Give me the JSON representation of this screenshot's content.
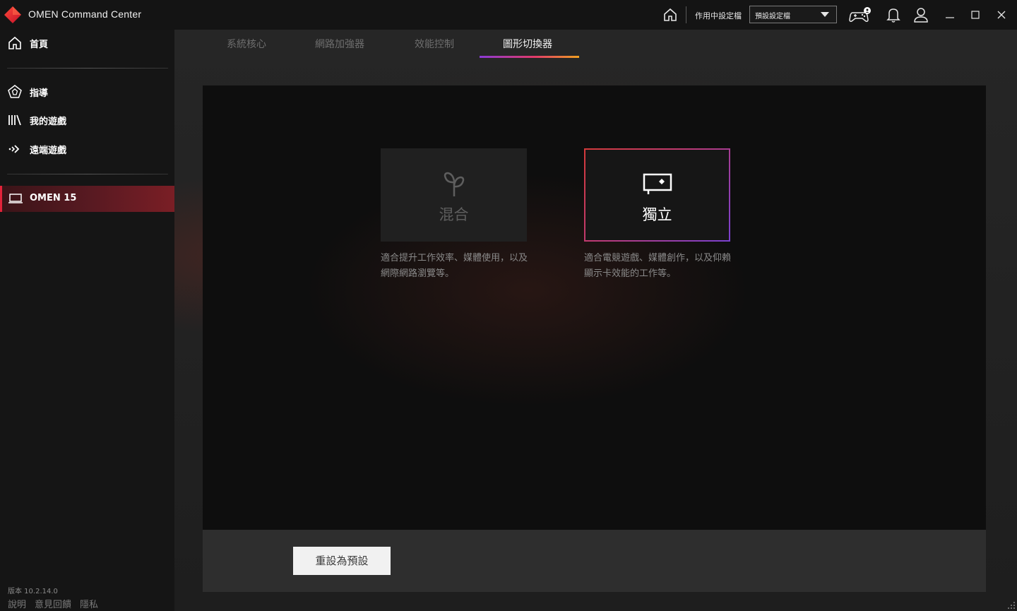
{
  "app": {
    "title": "OMEN Command Center"
  },
  "titlebar": {
    "profile_label": "作用中設定檔",
    "profile_select_value": "預設設定檔",
    "icons": [
      "home-icon",
      "controller-icon",
      "bell-icon",
      "user-icon",
      "minimize-icon",
      "maximize-icon",
      "close-icon"
    ]
  },
  "sidebar": {
    "home": "首頁",
    "items": [
      {
        "label": "指導",
        "icon": "coach-icon"
      },
      {
        "label": "我的遊戲",
        "icon": "library-icon"
      },
      {
        "label": "遠端遊戲",
        "icon": "remote-play-icon"
      }
    ],
    "device": "OMEN 15",
    "version": "版本 10.2.14.0",
    "footer": [
      "說明",
      "意見回饋",
      "隱私"
    ]
  },
  "tabs": [
    {
      "label": "系統核心",
      "active": false
    },
    {
      "label": "網路加強器",
      "active": false
    },
    {
      "label": "效能控制",
      "active": false
    },
    {
      "label": "圖形切換器",
      "active": true
    }
  ],
  "modes": {
    "hybrid": {
      "label": "混合",
      "description": "適合提升工作效率、媒體使用，以及網際網路瀏覽等。",
      "selected": false,
      "icon": "sprout-icon"
    },
    "discrete": {
      "label": "獨立",
      "description": "適合電競遊戲、媒體創作，以及仰賴顯示卡效能的工作等。",
      "selected": true,
      "icon": "display-icon"
    }
  },
  "reset_button": "重設為預設",
  "colors": {
    "accent_red": "#e2233a",
    "tab_gradient": [
      "#8a3ad6",
      "#e23a6a",
      "#f0a020"
    ]
  }
}
